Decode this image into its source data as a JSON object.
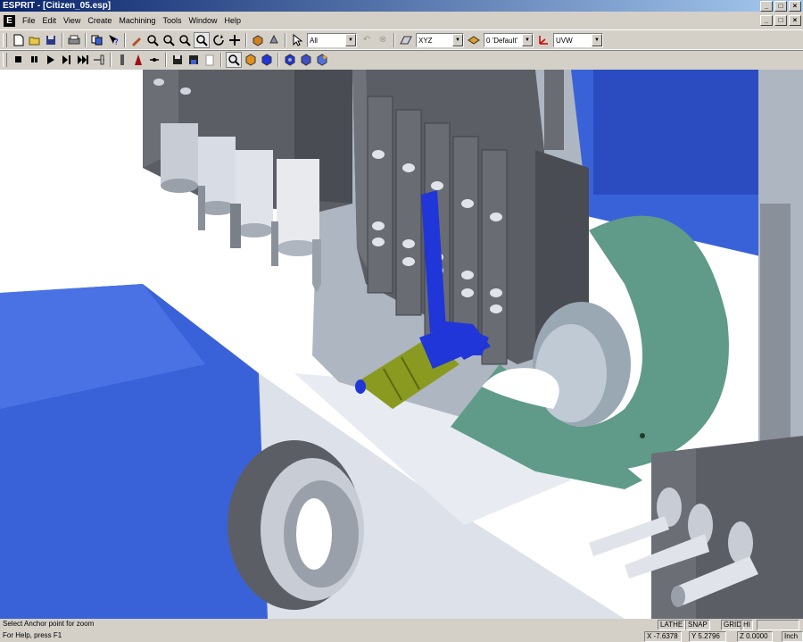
{
  "window": {
    "title": "ESPRIT - [Citizen_05.esp]",
    "app_icon_letter": "E",
    "buttons": [
      "_",
      "□",
      "×"
    ],
    "child_buttons": [
      "_",
      "□",
      "×"
    ]
  },
  "menu": {
    "items": [
      "File",
      "Edit",
      "View",
      "Create",
      "Machining",
      "Tools",
      "Window",
      "Help"
    ]
  },
  "toolbar1": {
    "layer_filter": "All",
    "work_plane": "XYZ",
    "layer": "0 'Default'",
    "axes": "UVW"
  },
  "statusbar": {
    "message": "Select Anchor point for zoom",
    "help": "For Help, press F1",
    "modes": {
      "lathe": "LATHE",
      "snap": "SNAP",
      "grid": "GRID",
      "hi": "HI"
    },
    "x": "X -7.6378",
    "y": "Y 5.2796",
    "z": "Z 0.0000",
    "units": "Inch"
  },
  "colors": {
    "title_gradient_start": "#0a246a",
    "chrome": "#d4d0c8",
    "machine_blue": "#3a62d8",
    "machine_gray": "#5c5e66",
    "chuck_teal": "#5f9b88",
    "tool_yellow": "#8a9a20",
    "tool_blue": "#2036d8"
  }
}
